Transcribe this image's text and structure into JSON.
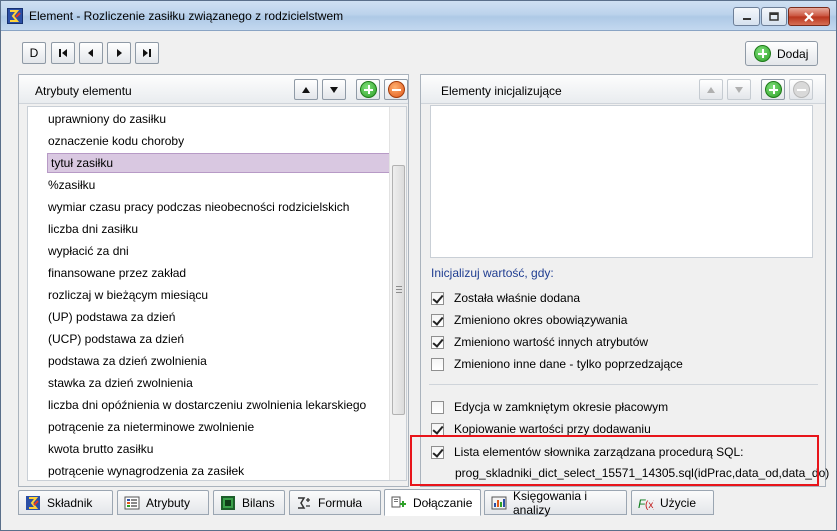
{
  "window": {
    "title": "Element - Rozliczenie zasiłku związanego z rodzicielstwem",
    "minimize_label": "–",
    "maximize_label": "□",
    "close_label": "✕"
  },
  "toolbar": {
    "first_label": "D",
    "dodaj_label": "Dodaj"
  },
  "left_panel": {
    "title": "Atrybuty elementu",
    "items": [
      "uprawniony do zasiłku",
      "oznaczenie kodu choroby",
      "tytuł zasiłku",
      "%zasiłku",
      "wymiar czasu pracy podczas nieobecności rodzicielskich",
      "liczba dni zasiłku",
      "wypłacić za dni",
      "finansowane przez zakład",
      "rozliczaj w bieżącym miesiącu",
      "(UP) podstawa za dzień",
      "(UCP) podstawa za dzień",
      "podstawa za dzień zwolnienia",
      "stawka za dzień zwolnienia",
      "liczba dni opóźnienia w dostarczeniu zwolnienia lekarskiego",
      "potrącenie za nieterminowe zwolnienie",
      "kwota brutto zasiłku",
      "potrącenie wynagrodzenia za zasiłek"
    ],
    "selected_index": 2
  },
  "right_panel": {
    "title": "Elementy inicjalizujące",
    "section_label": "Inicjalizuj wartość, gdy:",
    "init_conditions": [
      {
        "label": "Została właśnie dodana",
        "checked": true
      },
      {
        "label": "Zmieniono okres obowiązywania",
        "checked": true
      },
      {
        "label": "Zmieniono wartość innych atrybutów",
        "checked": true
      },
      {
        "label": "Zmieniono inne dane - tylko poprzedzające",
        "checked": false
      }
    ],
    "options": [
      {
        "label": "Edycja w zamkniętym okresie płacowym",
        "checked": false
      },
      {
        "label": "Kopiowanie wartości przy dodawaniu",
        "checked": true
      },
      {
        "label": "Lista elementów słownika zarządzana procedurą SQL:",
        "checked": true
      }
    ],
    "sql_procedure": "prog_skladniki_dict_select_15571_14305.sql(idPrac,data_od,data_do)"
  },
  "tabs": [
    {
      "label": "Składnik",
      "icon": "skladnik-icon"
    },
    {
      "label": "Atrybuty",
      "icon": "atrybuty-icon"
    },
    {
      "label": "Bilans",
      "icon": "bilans-icon"
    },
    {
      "label": "Formuła",
      "icon": "formula-icon"
    },
    {
      "label": "Dołączanie",
      "icon": "dolaczanie-icon",
      "active": true
    },
    {
      "label": "Księgowania i analizy",
      "icon": "ksiegowania-icon"
    },
    {
      "label": "Użycie",
      "icon": "fx-icon"
    }
  ],
  "colors": {
    "selection": "#d9c8e1",
    "highlight_border": "#e8141a",
    "section_label": "#1f3d91"
  }
}
